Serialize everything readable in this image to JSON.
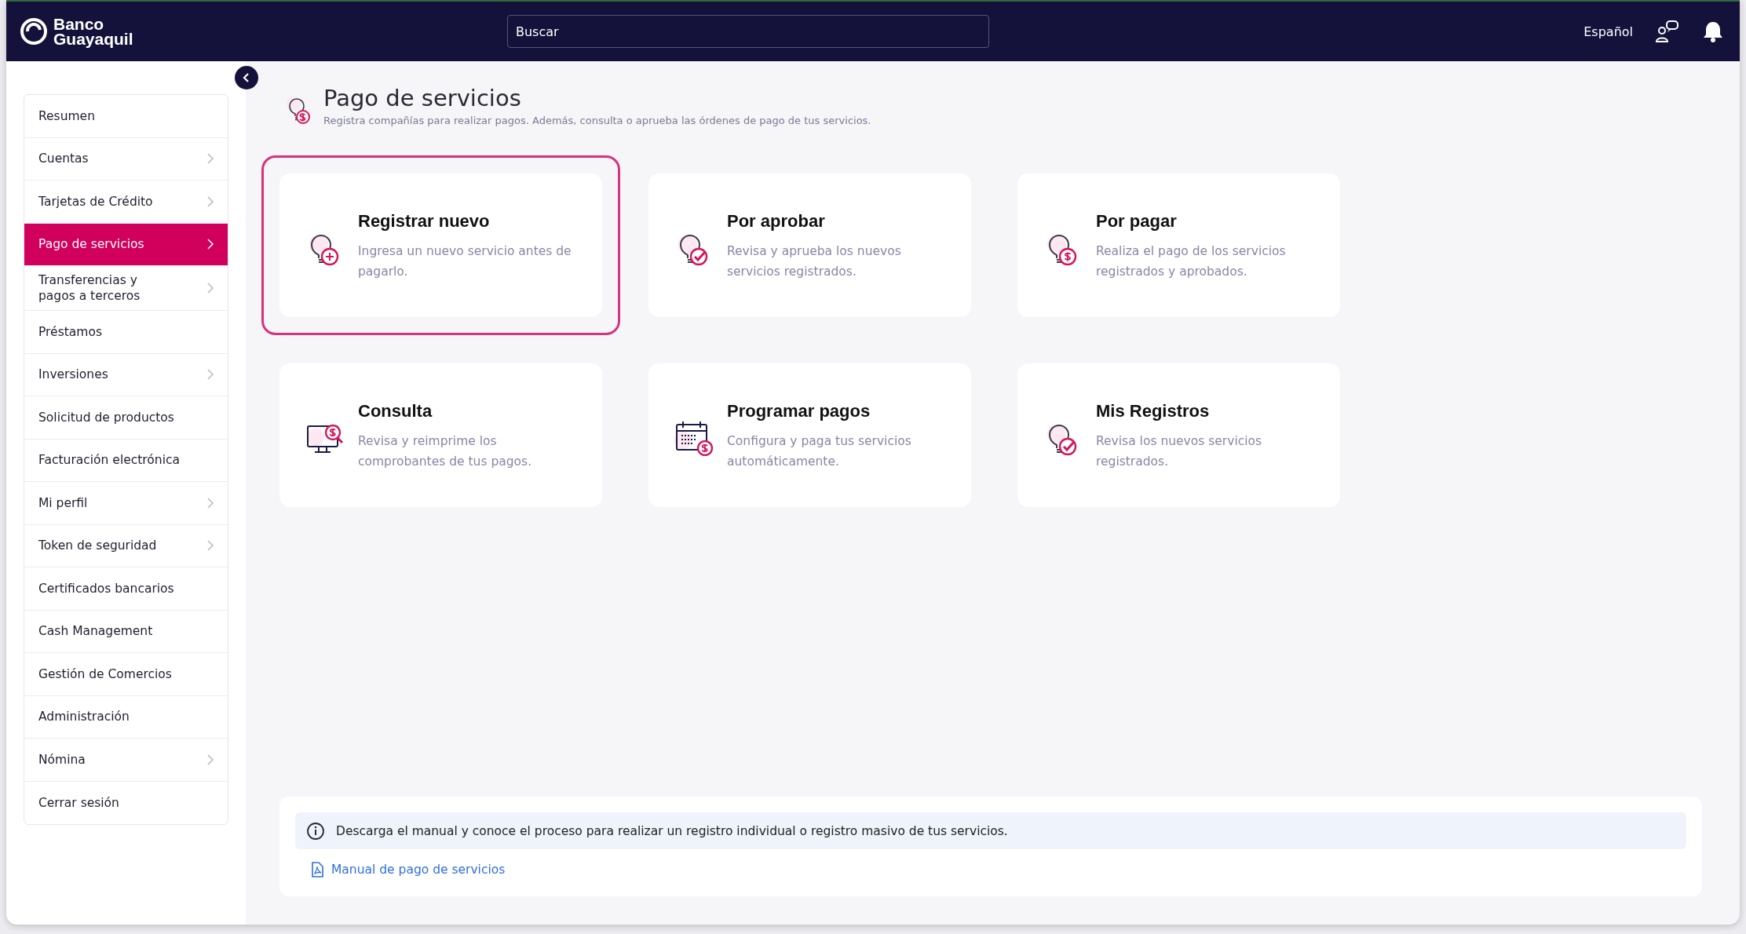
{
  "header": {
    "logo": "Banco\nGuayaquil",
    "search": {
      "placeholder": "Buscar"
    },
    "language": "Español"
  },
  "sidebar": {
    "items": [
      {
        "label": "Resumen",
        "selected": false,
        "has_submenu": false
      },
      {
        "label": "Cuentas",
        "selected": false,
        "has_submenu": true
      },
      {
        "label": "Tarjetas de Crédito",
        "selected": false,
        "has_submenu": true
      },
      {
        "label": "Pago de servicios",
        "selected": true,
        "has_submenu": true
      },
      {
        "label": "Transferencias y\npagos a terceros",
        "selected": false,
        "has_submenu": true
      },
      {
        "label": "Préstamos",
        "selected": false,
        "has_submenu": false
      },
      {
        "label": "Inversiones",
        "selected": false,
        "has_submenu": true
      },
      {
        "label": "Solicitud de productos",
        "selected": false,
        "has_submenu": false
      },
      {
        "label": "Facturación electrónica",
        "selected": false,
        "has_submenu": false
      },
      {
        "label": "Mi perfil",
        "selected": false,
        "has_submenu": true
      },
      {
        "label": "Token de seguridad",
        "selected": false,
        "has_submenu": true
      },
      {
        "label": "Certificados bancarios",
        "selected": false,
        "has_submenu": false
      },
      {
        "label": "Cash Management",
        "selected": false,
        "has_submenu": false
      },
      {
        "label": "Gestión de Comercios",
        "selected": false,
        "has_submenu": false
      },
      {
        "label": "Administración",
        "selected": false,
        "has_submenu": false
      },
      {
        "label": "Nómina",
        "selected": false,
        "has_submenu": true
      },
      {
        "label": "Cerrar sesión",
        "selected": false,
        "has_submenu": false
      }
    ]
  },
  "page": {
    "title": "Pago de servicios",
    "subtitle": "Registra compañías para realizar pagos. Además, consulta o aprueba las órdenes de pago de tus servicios."
  },
  "cards": [
    {
      "kind": "bulb-plus",
      "title": "Registrar nuevo",
      "description": "Ingresa un nuevo servicio antes de pagarlo.",
      "selected": true
    },
    {
      "kind": "bulb-check",
      "title": "Por aprobar",
      "description": "Revisa y aprueba los nuevos servicios registrados.",
      "selected": false
    },
    {
      "kind": "bulb-dollar",
      "title": "Por pagar",
      "description": "Realiza el pago de los servicios registrados y aprobados.",
      "selected": false
    },
    {
      "kind": "monitor",
      "title": "Consulta",
      "description": "Revisa y reimprime los comprobantes de tus pagos.",
      "selected": false
    },
    {
      "kind": "calendar",
      "title": "Programar pagos",
      "description": "Configura y paga tus servicios automáticamente.",
      "selected": false
    },
    {
      "kind": "bulb-check",
      "title": "Mis Registros",
      "description": "Revisa los nuevos servicios registrados.",
      "selected": false
    }
  ],
  "info": {
    "message": "Descarga el manual y conoce el proceso para realizar un registro individual o registro masivo de tus servicios.",
    "link": "Manual de pago de servicios"
  }
}
